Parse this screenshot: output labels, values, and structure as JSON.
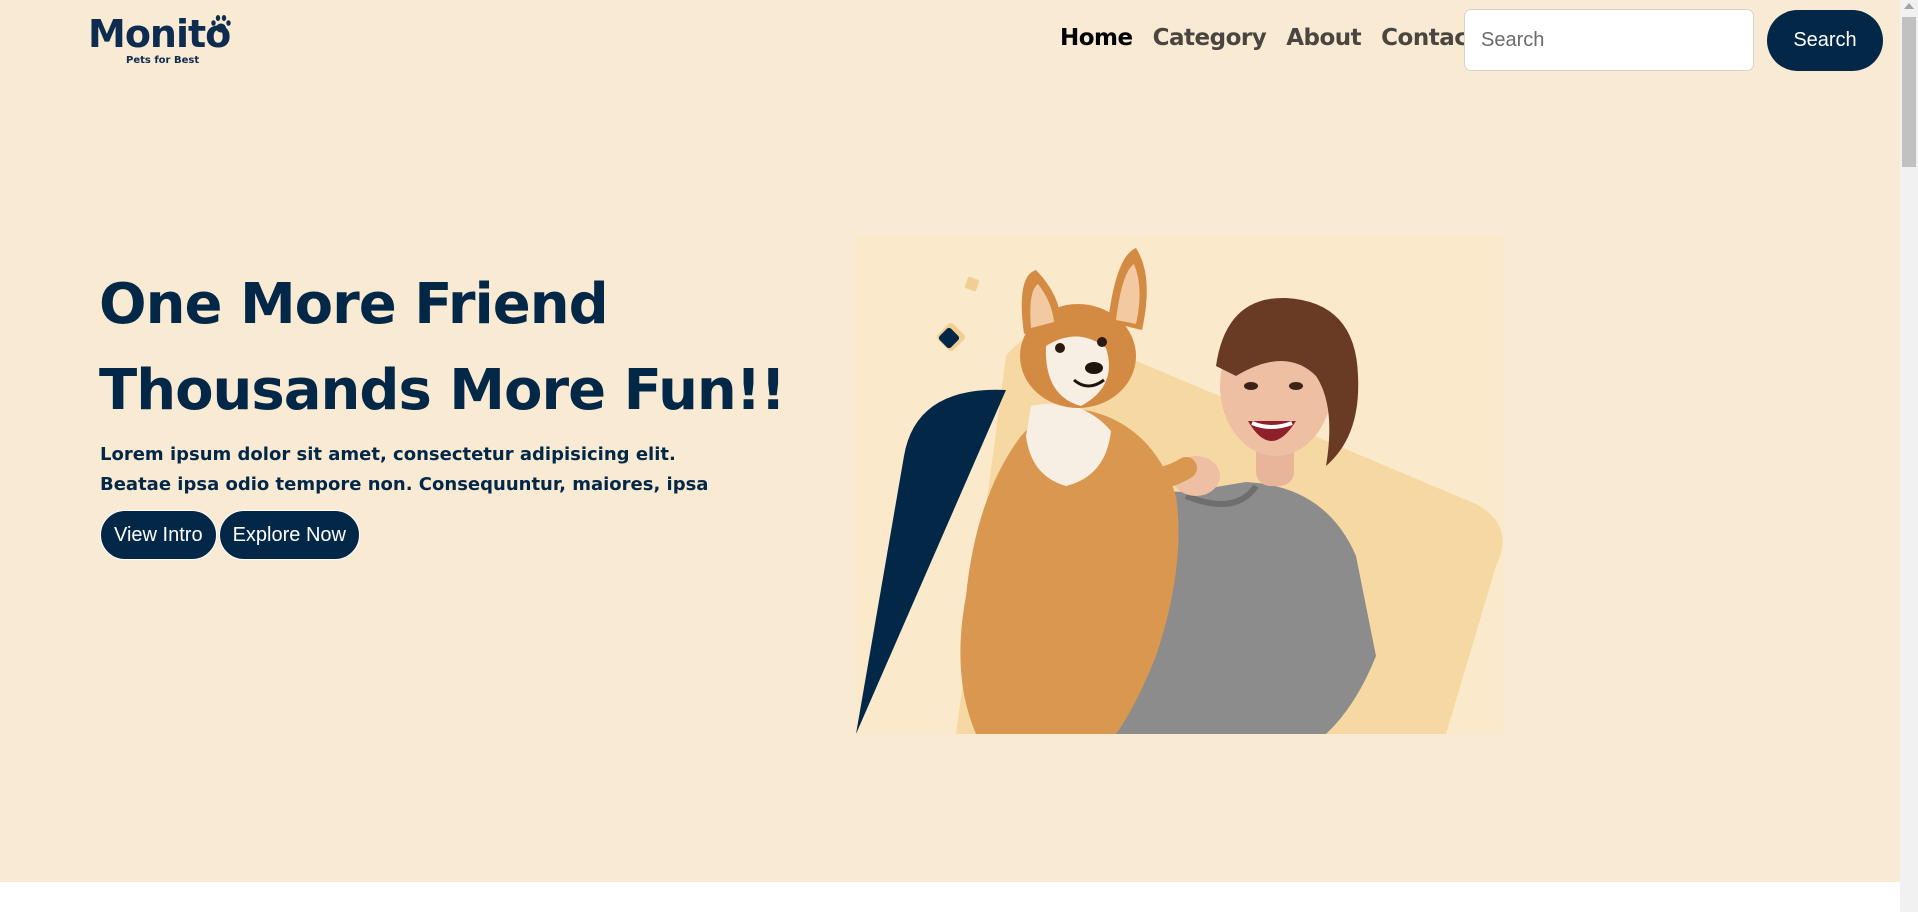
{
  "brand": {
    "name": "Monito",
    "tagline": "Pets for Best"
  },
  "nav": {
    "items": [
      {
        "label": "Home",
        "active": true
      },
      {
        "label": "Category",
        "active": false
      },
      {
        "label": "About",
        "active": false
      },
      {
        "label": "Contact",
        "active": false
      }
    ]
  },
  "search": {
    "placeholder": "Search",
    "value": "",
    "button_label": "Search"
  },
  "hero": {
    "title_line1": "One More Friend",
    "title_line2": "Thousands More Fun!!",
    "desc_line1": "Lorem ipsum dolor sit amet, consectetur adipisicing elit.",
    "desc_line2": "Beatae ipsa odio tempore non. Consequuntur, maiores, ipsa",
    "btn_intro": "View Intro",
    "btn_explore": "Explore Now"
  },
  "colors": {
    "page_background": "#f9ead4",
    "primary": "#032746",
    "nav_text": "#4b4540",
    "accent_shape": "#f6d9a2"
  },
  "icons": {
    "logo_paw": "paw-icon"
  }
}
